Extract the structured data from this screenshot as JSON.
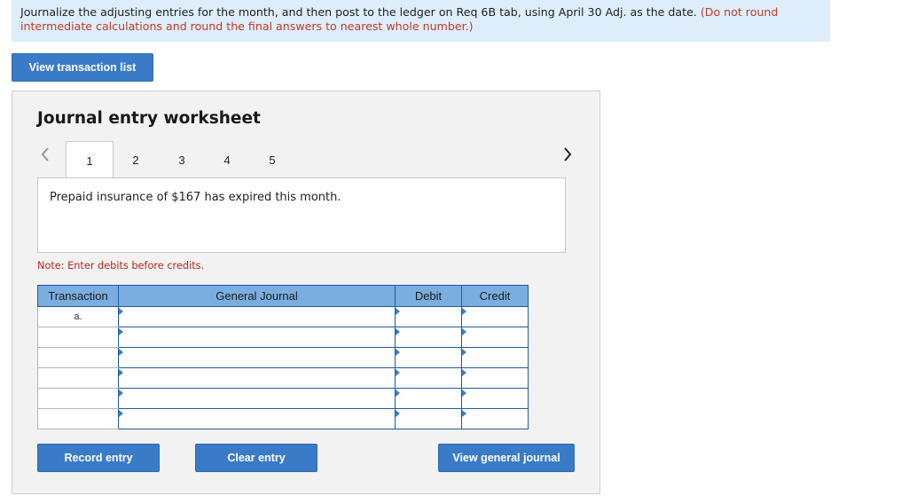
{
  "instructions": {
    "text": "Journalize the adjusting entries for the month, and then post to the ledger on Req 6B tab, using April 30 Adj. as the date.",
    "note": "(Do not round intermediate calculations and round the final answers to nearest whole number.)"
  },
  "buttons": {
    "view_transaction_list": "View transaction list",
    "record_entry": "Record entry",
    "clear_entry": "Clear entry",
    "view_general_journal": "View general journal"
  },
  "worksheet": {
    "title": "Journal entry worksheet",
    "tabs": [
      "1",
      "2",
      "3",
      "4",
      "5"
    ],
    "active_tab": "1",
    "description": "Prepaid insurance of $167 has expired this month.",
    "note": "Note: Enter debits before credits."
  },
  "journal": {
    "headers": [
      "Transaction",
      "General Journal",
      "Debit",
      "Credit"
    ],
    "rows": [
      {
        "transaction": "a.",
        "account": "",
        "debit": "",
        "credit": ""
      },
      {
        "transaction": "",
        "account": "",
        "debit": "",
        "credit": ""
      },
      {
        "transaction": "",
        "account": "",
        "debit": "",
        "credit": ""
      },
      {
        "transaction": "",
        "account": "",
        "debit": "",
        "credit": ""
      },
      {
        "transaction": "",
        "account": "",
        "debit": "",
        "credit": ""
      },
      {
        "transaction": "",
        "account": "",
        "debit": "",
        "credit": ""
      }
    ]
  },
  "colors": {
    "accent": "#3a7bc8",
    "header_bg": "#7aaee0",
    "instruction_bg": "#ddeefa",
    "note_red": "#b3261e"
  },
  "icons": {
    "prev": "chevron-left-icon",
    "next": "chevron-right-icon"
  }
}
